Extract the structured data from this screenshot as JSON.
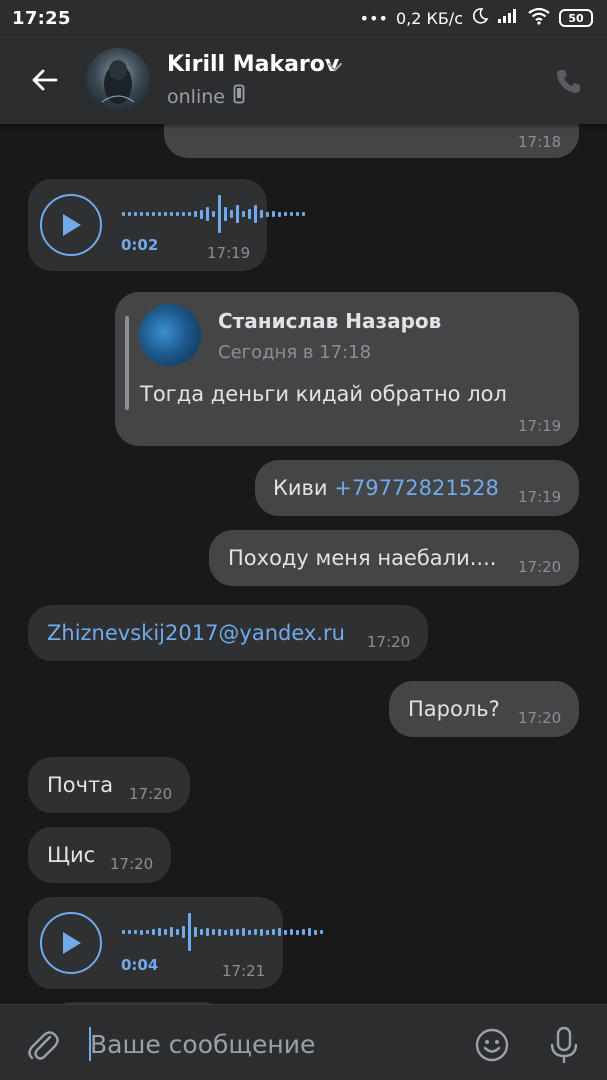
{
  "status_bar": {
    "time": "17:25",
    "dots": "•••",
    "speed": "0,2 КБ/с",
    "battery": "50"
  },
  "header": {
    "name": "Kirill Makarov",
    "status": "online",
    "icons": [
      "back-arrow-icon",
      "chevron-down-icon",
      "phone-icon",
      "mobile-icon"
    ]
  },
  "messages": {
    "m0": {
      "time": "17:18"
    },
    "m1": {
      "duration": "0:02",
      "time": "17:19"
    },
    "m2": {
      "quote_name": "Станислав Назаров",
      "quote_date": "Сегодня в 17:18",
      "text": "Тогда деньги кидай обратно лол",
      "time": "17:19"
    },
    "m3": {
      "text": "Киви ",
      "link": "+79772821528",
      "time": "17:19"
    },
    "m4": {
      "text": "Походу меня наебали....",
      "time": "17:20"
    },
    "m5": {
      "link": "Zhiznevskij2017@yandex.ru",
      "time": "17:20"
    },
    "m6": {
      "text": "Пароль?",
      "time": "17:20"
    },
    "m7": {
      "text": "Почта",
      "time": "17:20"
    },
    "m8": {
      "text": "Щис",
      "time": "17:20"
    },
    "m9": {
      "duration": "0:04",
      "time": "17:21"
    }
  },
  "composer": {
    "placeholder": "Ваше сообщение",
    "icons": [
      "paperclip-icon",
      "emoji-icon",
      "microphone-icon"
    ]
  },
  "colors": {
    "accent": "#71aaeb",
    "background": "#19191a",
    "bar": "#2c2d2f",
    "bubble_out": "#444547",
    "bubble_in": "#2f3032"
  }
}
